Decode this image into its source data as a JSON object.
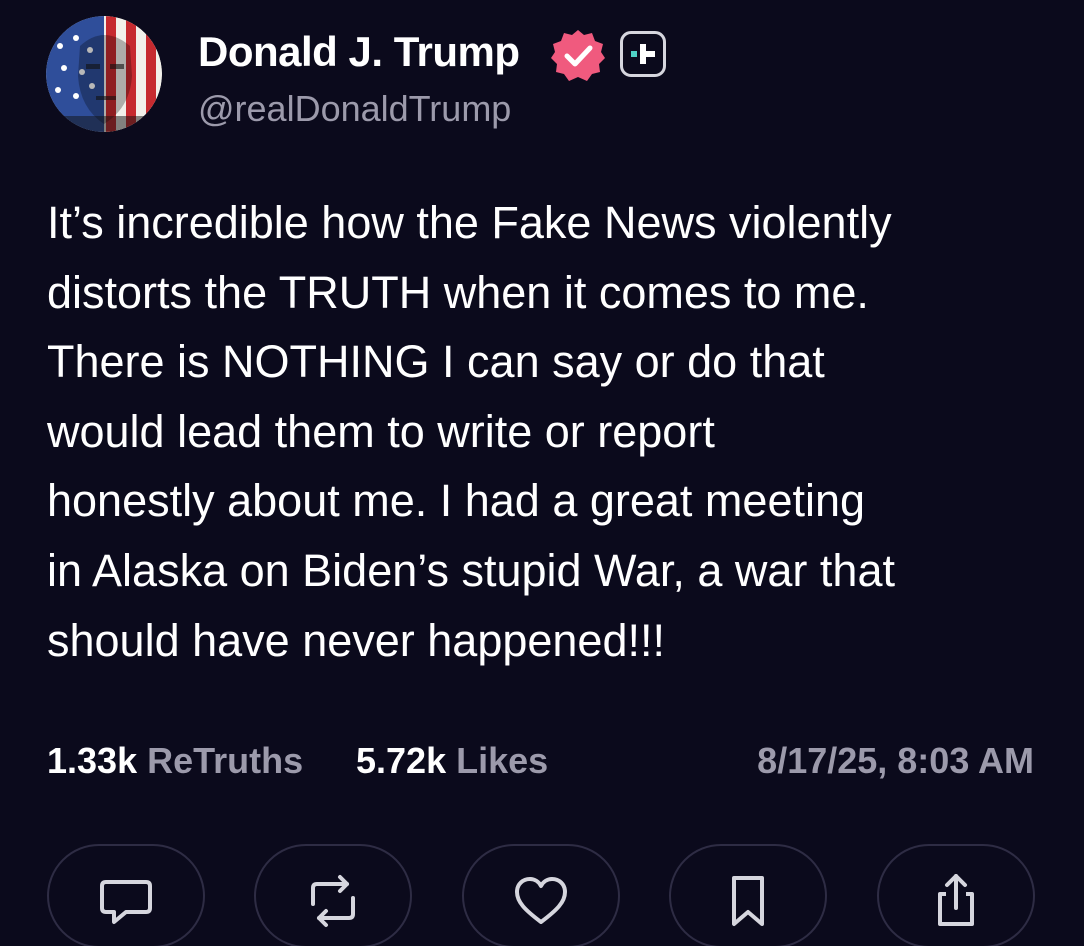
{
  "author": {
    "display_name": "Donald J. Trump",
    "handle": "@realDonaldTrump",
    "verified_badge_color": "#f05a7e",
    "avatar_icon": "flag-portrait-avatar"
  },
  "post": {
    "lines": [
      "It’s incredible how the Fake News violently",
      "distorts the TRUTH when it comes to me.",
      "There is NOTHING I can say or do that",
      "would lead them to write or report",
      "honestly about me. I had a great meeting",
      "in Alaska on Biden’s stupid War, a war that",
      "should have never happened!!!"
    ]
  },
  "stats": {
    "retruths_count": "1.33k",
    "retruths_label": "ReTruths",
    "likes_count": "5.72k",
    "likes_label": "Likes",
    "timestamp": "8/17/25, 8:03 AM"
  },
  "actions": [
    {
      "name": "reply",
      "icon": "comment-icon"
    },
    {
      "name": "retruth",
      "icon": "repost-icon"
    },
    {
      "name": "like",
      "icon": "heart-icon"
    },
    {
      "name": "bookmark",
      "icon": "bookmark-icon"
    },
    {
      "name": "share",
      "icon": "share-icon"
    }
  ],
  "colors": {
    "background": "#0b0a1c",
    "text": "#ffffff",
    "muted": "#9c9aab",
    "plus_accent": "#4fd1c5"
  }
}
